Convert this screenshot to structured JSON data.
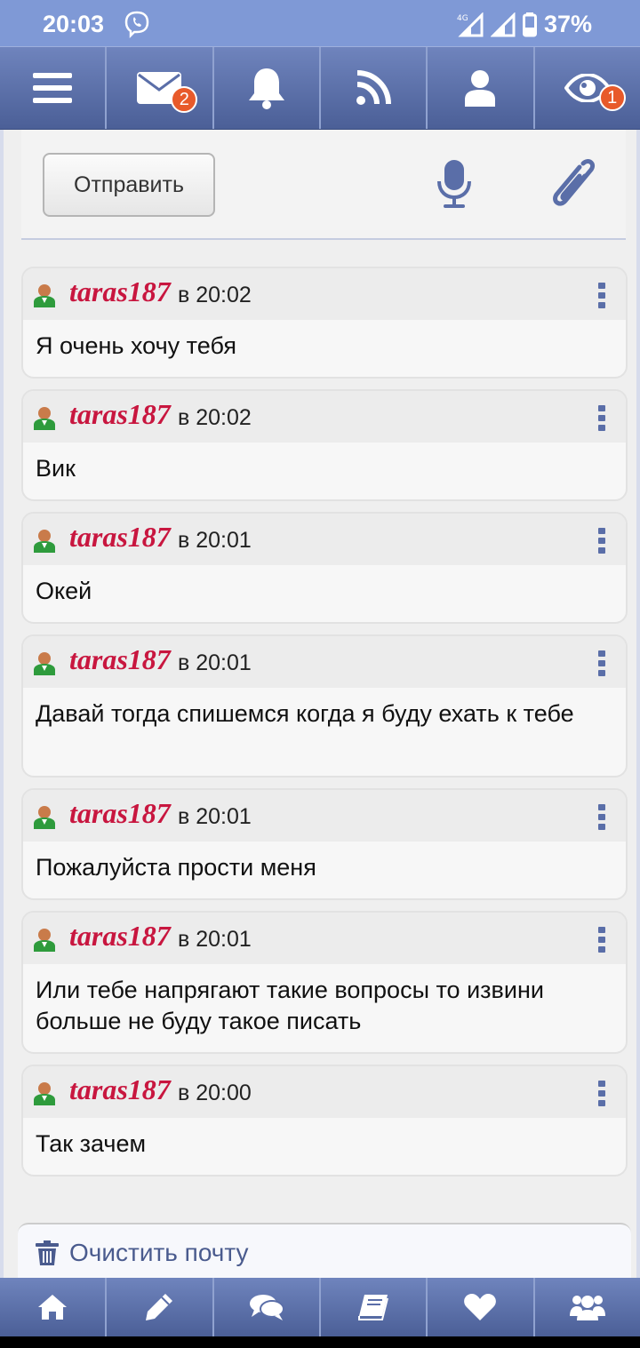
{
  "status_bar": {
    "time": "20:03",
    "network": "4G",
    "battery": "37%",
    "icons": [
      "viber-icon",
      "signal-icon",
      "signal-icon",
      "battery-icon"
    ]
  },
  "top_nav": {
    "items": [
      {
        "icon": "menu-icon",
        "badge": ""
      },
      {
        "icon": "mail-icon",
        "badge": "2"
      },
      {
        "icon": "bell-icon",
        "badge": ""
      },
      {
        "icon": "rss-icon",
        "badge": ""
      },
      {
        "icon": "user-icon",
        "badge": ""
      },
      {
        "icon": "eye-icon",
        "badge": "1"
      }
    ]
  },
  "composer": {
    "send_label": "Отправить",
    "icons": [
      "microphone-icon",
      "paperclip-icon"
    ]
  },
  "messages": [
    {
      "user": "taras187",
      "time": "в 20:02",
      "text": "Я очень хочу тебя"
    },
    {
      "user": "taras187",
      "time": "в 20:02",
      "text": "Вик"
    },
    {
      "user": "taras187",
      "time": "в 20:01",
      "text": "Окей"
    },
    {
      "user": "taras187",
      "time": "в 20:01",
      "text": "Давай тогда спишемся когда я буду ехать к тебе"
    },
    {
      "user": "taras187",
      "time": "в 20:01",
      "text": "Пожалуйста прости меня"
    },
    {
      "user": "taras187",
      "time": "в 20:01",
      "text": "Или тебе напрягают такие вопросы то извини больше не буду такое писать"
    },
    {
      "user": "taras187",
      "time": "в 20:00",
      "text": "Так зачем"
    }
  ],
  "clear_mail": {
    "label": "Очистить почту",
    "icon": "trash-icon"
  },
  "bottom_nav": {
    "items": [
      "home-icon",
      "pencil-icon",
      "chat-icon",
      "book-icon",
      "heart-icon",
      "users-icon"
    ]
  },
  "colors": {
    "status_bar": "#7f99d6",
    "nav": "#5a6ea8",
    "username": "#c8163f",
    "badge": "#e85a2a",
    "accent_icon": "#4a5b8e"
  }
}
